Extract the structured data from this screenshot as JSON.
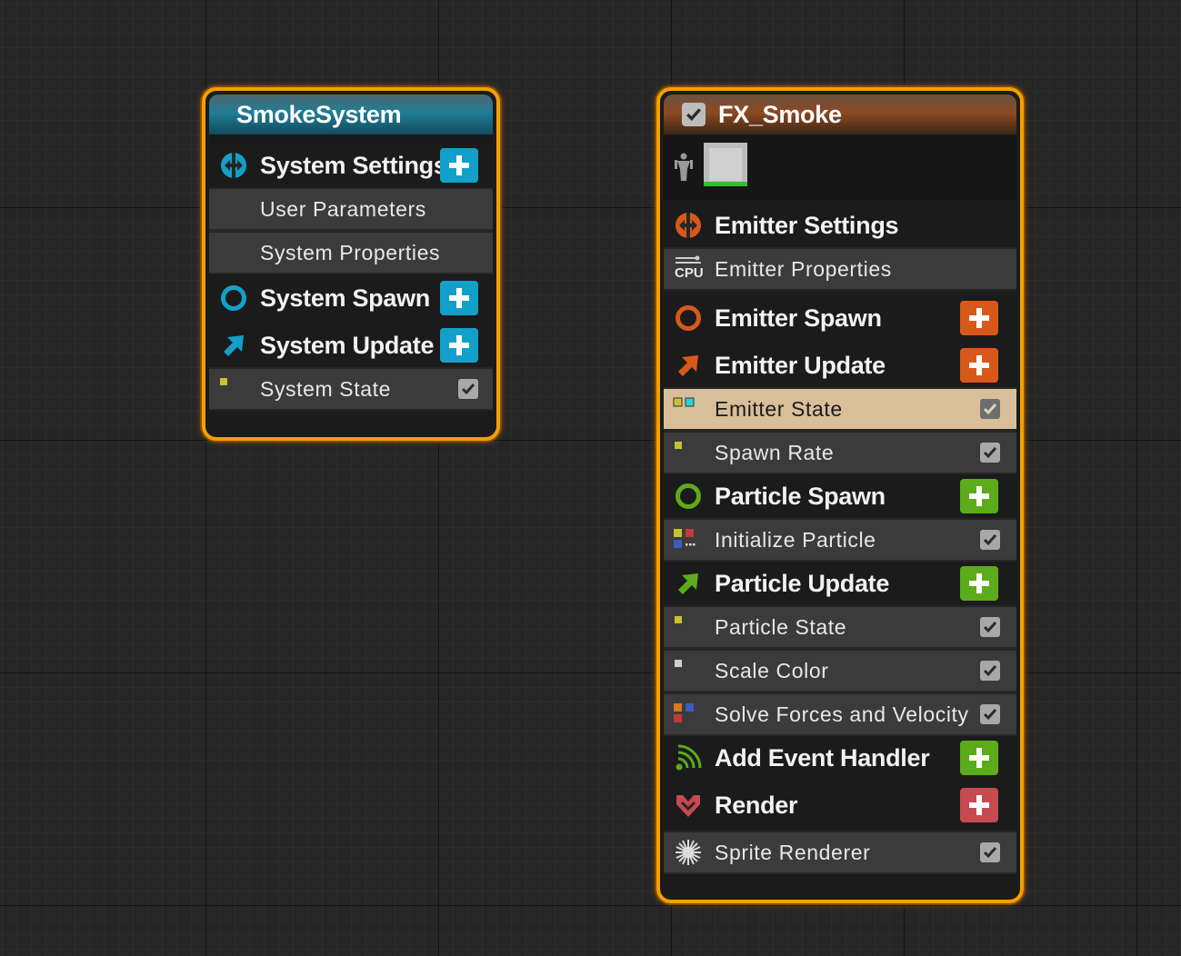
{
  "system_node": {
    "title": "SmokeSystem",
    "rows": {
      "system_settings": "System Settings",
      "user_parameters": "User Parameters",
      "system_properties": "System Properties",
      "system_spawn": "System Spawn",
      "system_update": "System Update",
      "system_state": "System State"
    },
    "system_state_enabled": true
  },
  "emitter_node": {
    "title": "FX_Smoke",
    "enabled": true,
    "sim_target_badge": "CPU",
    "rows": {
      "emitter_settings": "Emitter Settings",
      "emitter_properties": "Emitter Properties",
      "emitter_spawn": "Emitter Spawn",
      "emitter_update": "Emitter Update",
      "emitter_state": "Emitter State",
      "spawn_rate": "Spawn Rate",
      "particle_spawn": "Particle Spawn",
      "initialize_particle": "Initialize Particle",
      "particle_update": "Particle Update",
      "particle_state": "Particle State",
      "scale_color": "Scale Color",
      "solve_forces": "Solve Forces and Velocity",
      "add_event_handler": "Add Event Handler",
      "render": "Render",
      "sprite_renderer": "Sprite Renderer"
    },
    "selected_module": "Emitter State",
    "all_modules_enabled": true
  },
  "colors": {
    "system_accent": "#13a0c8",
    "emitter_accent": "#d8581a",
    "particle_accent": "#5cab1a",
    "render_accent": "#c64a52",
    "node_border": "#f2a100",
    "selected_row": "#d8bf9a"
  },
  "icons": {
    "settings": "settings-arrows-icon",
    "spawn": "spawn-ring-icon",
    "update": "update-arrow-icon",
    "event": "event-signal-icon",
    "render": "render-chevron-icon",
    "sprite": "sprite-burst-icon",
    "add": "plus-icon",
    "check": "checkmark-icon"
  }
}
